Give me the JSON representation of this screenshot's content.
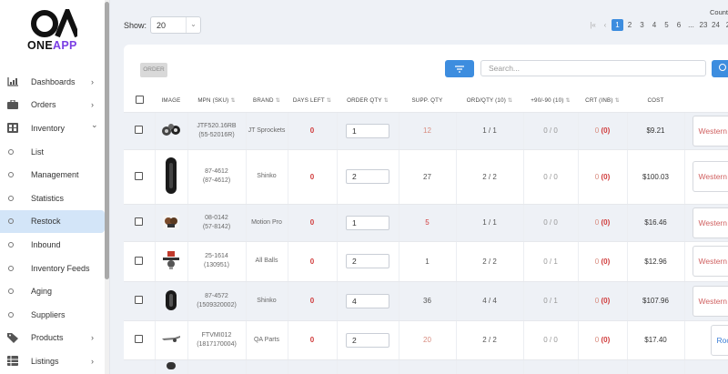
{
  "logo": {
    "text_main": "ONE",
    "text_accent": "APP"
  },
  "sidebar": {
    "items": [
      {
        "label": "Dashboards",
        "icon": "chart-icon",
        "chevron": "›"
      },
      {
        "label": "Orders",
        "icon": "briefcase-icon",
        "chevron": "›"
      },
      {
        "label": "Inventory",
        "icon": "grid-icon",
        "chevron": "⌄"
      },
      {
        "label": "List"
      },
      {
        "label": "Management"
      },
      {
        "label": "Statistics"
      },
      {
        "label": "Restock",
        "active": true
      },
      {
        "label": "Inbound"
      },
      {
        "label": "Inventory Feeds"
      },
      {
        "label": "Aging"
      },
      {
        "label": "Suppliers"
      },
      {
        "label": "Products",
        "icon": "tag-icon",
        "chevron": "›"
      },
      {
        "label": "Listings",
        "icon": "table-icon",
        "chevron": "›"
      }
    ]
  },
  "toolbar": {
    "show_label": "Show:",
    "show_value": "20",
    "count_label": "Count",
    "order_label": "ORDER",
    "search_placeholder": "Search..."
  },
  "pager": {
    "first": "|«",
    "prev": "‹",
    "pages": [
      "1",
      "2",
      "3",
      "4",
      "5",
      "6",
      "...",
      "23",
      "24",
      "2"
    ],
    "active": "1"
  },
  "table": {
    "headers": [
      "IMAGE",
      "MPN (SKU)",
      "BRAND",
      "DAYS LEFT",
      "ORDER QTY",
      "SUPP. QTY",
      "ORD/QTY (10)",
      "+90/-90 (10)",
      "CRT (INB)",
      "COST"
    ],
    "rows": [
      {
        "mpn": "JTF520.16RB",
        "sku": "(55-52016R)",
        "brand": "JT Sprockets",
        "days": "0",
        "qty": "1",
        "supp": "12",
        "ordqty": "1 / 1",
        "p90": "0 / 0",
        "crt": "0",
        "inb": "(0)",
        "cost": "$9.21",
        "supplier": "Western Po",
        "img": "sprocket"
      },
      {
        "mpn": "87-4612",
        "sku": "(87-4612)",
        "brand": "Shinko",
        "days": "0",
        "qty": "2",
        "supp": "27",
        "ordqty": "2 / 2",
        "p90": "0 / 0",
        "crt": "0",
        "inb": "(0)",
        "cost": "$100.03",
        "supplier": "Western Po",
        "img": "tire"
      },
      {
        "mpn": "08-0142",
        "sku": "(57-8142)",
        "brand": "Motion Pro",
        "days": "0",
        "qty": "1",
        "supp": "5",
        "ordqty": "1 / 1",
        "p90": "0 / 0",
        "crt": "0",
        "inb": "(0)",
        "cost": "$16.46",
        "supplier": "Western Po",
        "img": "part"
      },
      {
        "mpn": "25-1614",
        "sku": "(130951)",
        "brand": "All Balls",
        "days": "0",
        "qty": "2",
        "supp": "1",
        "ordqty": "2 / 2",
        "p90": "0 / 1",
        "crt": "0",
        "inb": "(0)",
        "cost": "$12.96",
        "supplier": "Western Po",
        "img": "kit"
      },
      {
        "mpn": "87-4572",
        "sku": "(1509320002)",
        "brand": "Shinko",
        "days": "0",
        "qty": "4",
        "supp": "36",
        "ordqty": "4 / 4",
        "p90": "0 / 1",
        "crt": "0",
        "inb": "(0)",
        "cost": "$107.96",
        "supplier": "Western Po",
        "img": "tire2"
      },
      {
        "mpn": "FTVMI012",
        "sku": "(1817170004)",
        "brand": "QA Parts",
        "days": "0",
        "qty": "2",
        "supp": "20",
        "ordqty": "2 / 2",
        "p90": "0 / 0",
        "crt": "0",
        "inb": "(0)",
        "cost": "$17.40",
        "supplier": "Roc",
        "img": "lever"
      }
    ]
  }
}
